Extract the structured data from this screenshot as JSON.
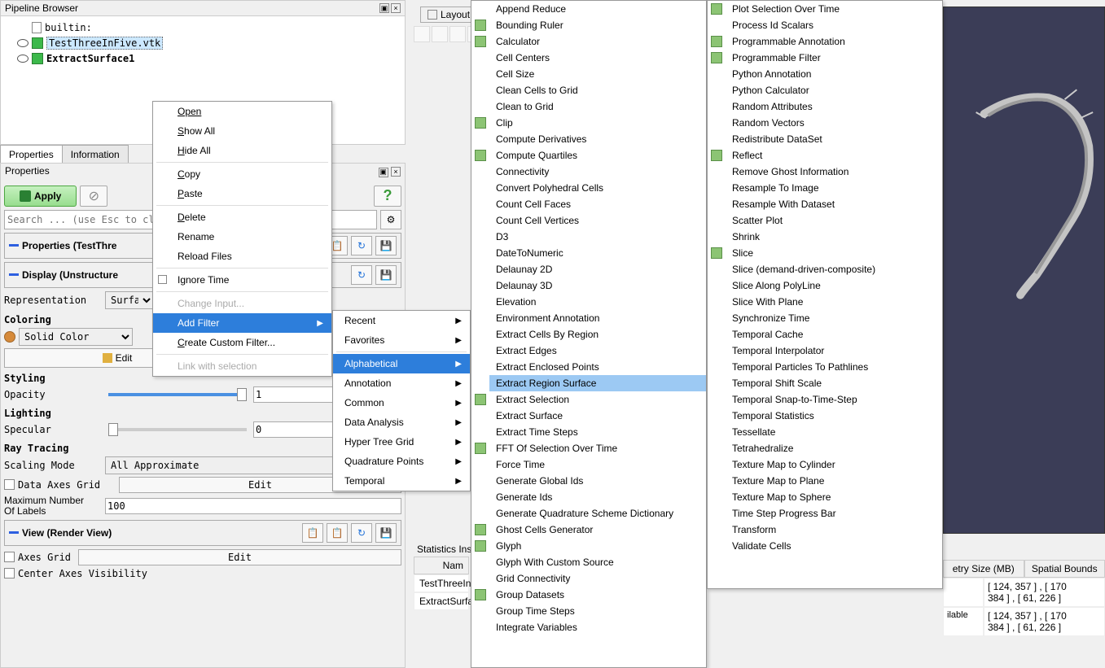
{
  "pipeline": {
    "title": "Pipeline Browser",
    "items": [
      {
        "label": "builtin:"
      },
      {
        "label": "TestThreeInFive.vtk"
      },
      {
        "label": "ExtractSurface1"
      }
    ]
  },
  "tabs": {
    "properties": "Properties",
    "information": "Information"
  },
  "properties": {
    "header": "Properties",
    "apply": "Apply",
    "search_placeholder": "Search ... (use Esc to clear",
    "section_props": "Properties (TestThre",
    "section_display": "Display (Unstructure",
    "representation_label": "Representation",
    "representation_value": "Surface",
    "coloring_heading": "Coloring",
    "solid_color": "Solid Color",
    "edit_btn": "Edit",
    "styling_heading": "Styling",
    "opacity_label": "Opacity",
    "opacity_value": "1",
    "lighting_heading": "Lighting",
    "specular_label": "Specular",
    "specular_value": "0",
    "raytracing_heading": "Ray Tracing",
    "scaling_mode_label": "Scaling Mode",
    "scaling_mode_value": "All Approximate",
    "data_axes_grid": "Data Axes Grid",
    "max_labels_label1": "Maximum Number",
    "max_labels_label2": "Of Labels",
    "max_labels_value": "100",
    "section_view": "View (Render View)",
    "axes_grid": "Axes Grid",
    "center_axes": "Center Axes Visibility"
  },
  "context_menu": [
    {
      "label": "Open",
      "underline": true,
      "icon": "folder"
    },
    {
      "label": "Show All",
      "underline_char": 0,
      "icon": "eye"
    },
    {
      "label": "Hide All",
      "underline_char": 0,
      "icon": "eye-off",
      "sep_after": true
    },
    {
      "label": "Copy",
      "underline_char": 0,
      "icon": "copy"
    },
    {
      "label": "Paste",
      "underline_char": 0,
      "icon": "paste",
      "sep_after": true
    },
    {
      "label": "Delete",
      "underline_char": 0,
      "icon": "x"
    },
    {
      "label": "Rename"
    },
    {
      "label": "Reload Files",
      "sep_after": true
    },
    {
      "label": "Ignore Time",
      "checkbox": true,
      "sep_after": true
    },
    {
      "label": "Change Input...",
      "disabled": true
    },
    {
      "label": "Add Filter",
      "sub": true,
      "highlighted": true
    },
    {
      "label": "Create Custom Filter...",
      "underline_char": 0,
      "sep_after": true
    },
    {
      "label": "Link with selection",
      "disabled": true
    }
  ],
  "filter_categories": [
    {
      "label": "Recent",
      "sub": true
    },
    {
      "label": "Favorites",
      "sub": true,
      "sep_after": true
    },
    {
      "label": "Alphabetical",
      "sub": true,
      "highlighted": true
    },
    {
      "label": "Annotation",
      "sub": true
    },
    {
      "label": "Common",
      "sub": true
    },
    {
      "label": "Data Analysis",
      "sub": true
    },
    {
      "label": "Hyper Tree Grid",
      "sub": true
    },
    {
      "label": "Quadrature Points",
      "sub": true
    },
    {
      "label": "Temporal",
      "sub": true
    }
  ],
  "filters_col1": [
    {
      "label": "Append Reduce"
    },
    {
      "label": "Bounding Ruler",
      "icon": "ruler"
    },
    {
      "label": "Calculator",
      "icon": "calc"
    },
    {
      "label": "Cell Centers"
    },
    {
      "label": "Cell Size"
    },
    {
      "label": "Clean Cells to Grid"
    },
    {
      "label": "Clean to Grid"
    },
    {
      "label": "Clip",
      "icon": "clip"
    },
    {
      "label": "Compute Derivatives"
    },
    {
      "label": "Compute Quartiles",
      "icon": "quart"
    },
    {
      "label": "Connectivity"
    },
    {
      "label": "Convert Polyhedral Cells"
    },
    {
      "label": "Count Cell Faces"
    },
    {
      "label": "Count Cell Vertices"
    },
    {
      "label": "D3"
    },
    {
      "label": "DateToNumeric"
    },
    {
      "label": "Delaunay 2D"
    },
    {
      "label": "Delaunay 3D"
    },
    {
      "label": "Elevation"
    },
    {
      "label": "Environment Annotation"
    },
    {
      "label": "Extract Cells By Region"
    },
    {
      "label": "Extract Edges"
    },
    {
      "label": "Extract Enclosed Points"
    },
    {
      "label": "Extract Region Surface",
      "highlighted": true
    },
    {
      "label": "Extract Selection",
      "icon": "sel"
    },
    {
      "label": "Extract Surface"
    },
    {
      "label": "Extract Time Steps"
    },
    {
      "label": "FFT Of Selection Over Time",
      "icon": "fft"
    },
    {
      "label": "Force Time"
    },
    {
      "label": "Generate Global Ids"
    },
    {
      "label": "Generate Ids"
    },
    {
      "label": "Generate Quadrature Scheme Dictionary"
    },
    {
      "label": "Ghost Cells Generator",
      "icon": "ghost"
    },
    {
      "label": "Glyph",
      "icon": "glyph"
    },
    {
      "label": "Glyph With Custom Source"
    },
    {
      "label": "Grid Connectivity"
    },
    {
      "label": "Group Datasets",
      "icon": "group"
    },
    {
      "label": "Group Time Steps"
    },
    {
      "label": "Integrate Variables"
    }
  ],
  "filters_col2": [
    {
      "label": "Plot Selection Over Time",
      "icon": "plot"
    },
    {
      "label": "Process Id Scalars"
    },
    {
      "label": "Programmable Annotation",
      "icon": "prog"
    },
    {
      "label": "Programmable Filter",
      "icon": "prog"
    },
    {
      "label": "Python Annotation"
    },
    {
      "label": "Python Calculator"
    },
    {
      "label": "Random Attributes"
    },
    {
      "label": "Random Vectors"
    },
    {
      "label": "Redistribute DataSet"
    },
    {
      "label": "Reflect",
      "icon": "reflect"
    },
    {
      "label": "Remove Ghost Information"
    },
    {
      "label": "Resample To Image"
    },
    {
      "label": "Resample With Dataset"
    },
    {
      "label": "Scatter Plot"
    },
    {
      "label": "Shrink"
    },
    {
      "label": "Slice",
      "icon": "slice"
    },
    {
      "label": "Slice (demand-driven-composite)"
    },
    {
      "label": "Slice Along PolyLine"
    },
    {
      "label": "Slice With Plane"
    },
    {
      "label": "Synchronize Time"
    },
    {
      "label": "Temporal Cache"
    },
    {
      "label": "Temporal Interpolator"
    },
    {
      "label": "Temporal Particles To Pathlines"
    },
    {
      "label": "Temporal Shift Scale"
    },
    {
      "label": "Temporal Snap-to-Time-Step"
    },
    {
      "label": "Temporal Statistics"
    },
    {
      "label": "Tessellate"
    },
    {
      "label": "Tetrahedralize"
    },
    {
      "label": "Texture Map to Cylinder"
    },
    {
      "label": "Texture Map to Plane"
    },
    {
      "label": "Texture Map to Sphere"
    },
    {
      "label": "Time Step Progress Bar"
    },
    {
      "label": "Transform"
    },
    {
      "label": "Validate Cells"
    }
  ],
  "layout": {
    "tab": "Layout"
  },
  "stats": {
    "title": "Statistics Ins",
    "headers": [
      "Nam",
      "etry Size (MB)",
      "Spatial Bounds"
    ],
    "rows": [
      {
        "name": "TestThreeIn",
        "avail": "",
        "bounds1": "[ 124, 357 ] , [ 170",
        "bounds2": "384 ] , [ 61, 226 ]"
      },
      {
        "name": "ExtractSurfa",
        "avail": "ilable",
        "bounds1": "[ 124, 357 ] , [ 170",
        "bounds2": "384 ] , [ 61, 226 ]"
      }
    ]
  }
}
